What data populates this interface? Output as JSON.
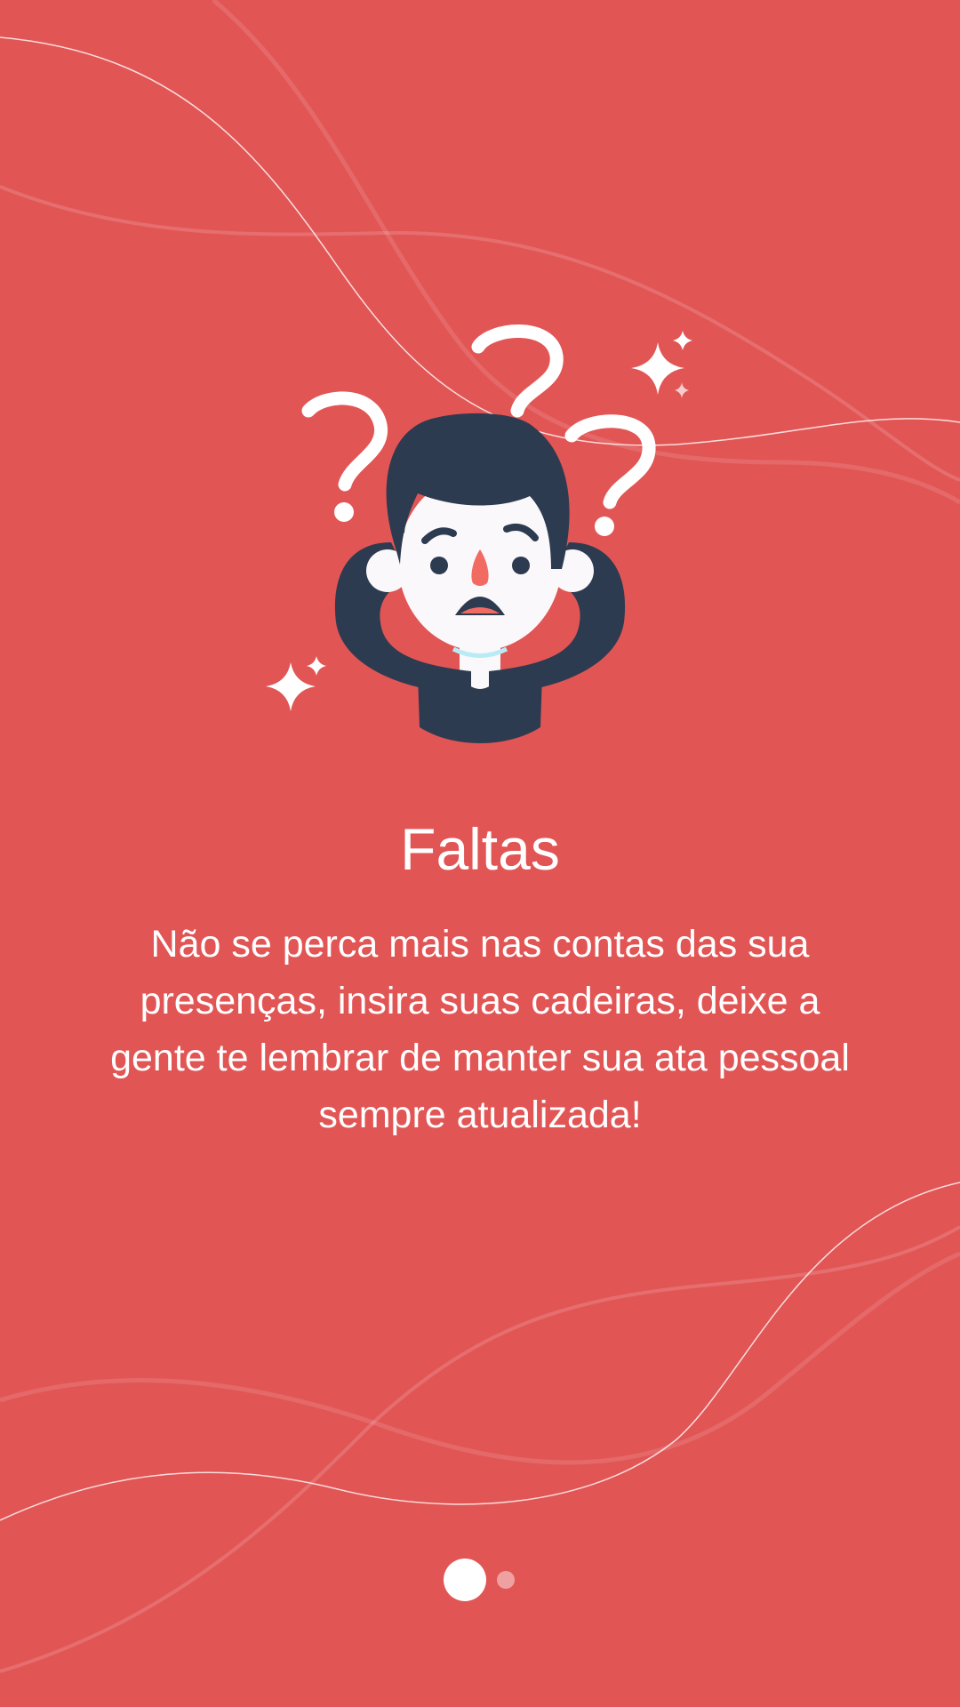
{
  "onboarding": {
    "title": "Faltas",
    "description": "Não se perca mais nas contas das sua presenças, insira suas cadeiras, deixe a gente te lembrar de manter sua ata pessoal sempre atualizada!",
    "illustration_icon": "confused-student-icon",
    "background_color": "#e25555"
  },
  "pager": {
    "total_pages": 2,
    "current_page": 1
  }
}
